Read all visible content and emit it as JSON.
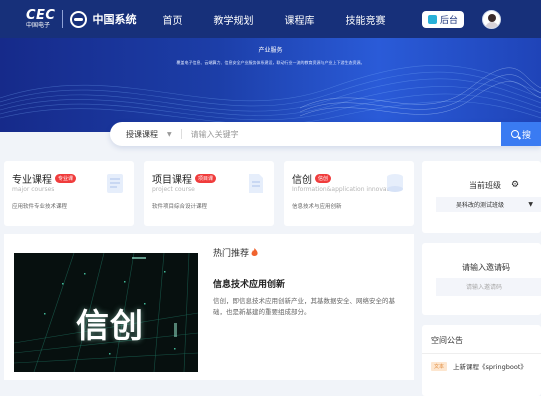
{
  "header": {
    "cec_logo": "CEC",
    "cec_subtitle": "中国电子",
    "partner_logo": "中国系统",
    "nav": [
      "首页",
      "教学规划",
      "课程库",
      "技能竞赛"
    ],
    "backend_label": "后台"
  },
  "banner": {
    "title": "产业服务",
    "subtitle": "覆盖电子信息、云端算力、信息安全产业服务体系建设，联动行业一流的教育资源与产业上下游生态资源。"
  },
  "search": {
    "category": "授课课程",
    "placeholder": "请输入关键字",
    "button_label": "搜"
  },
  "cards": [
    {
      "title": "专业课程",
      "tag": "专业课",
      "en": "major courses",
      "desc": "应用软件专业技术课程"
    },
    {
      "title": "项目课程",
      "tag": "项目课",
      "en": "project course",
      "desc": "软件项目综合设计课程"
    },
    {
      "title": "信创",
      "tag": "信创",
      "en": "Information&application innovation",
      "desc": "信息技术与应用创新"
    }
  ],
  "current_class": {
    "title": "当前班级",
    "selected": "吴科改的测试班级"
  },
  "invite": {
    "title": "请输入邀请码",
    "placeholder": "请输入邀请码"
  },
  "notice": {
    "title": "空间公告",
    "items": [
      {
        "tag": "文本",
        "text": "上新课程《springboot》"
      }
    ]
  },
  "hot": {
    "heading": "热门推荐",
    "image_text": "信创",
    "title": "信息技术应用创新",
    "desc": "信创，即信息技术应用创新产业，其基数据安全、网络安全的基础，也是新基建的重要组成部分。"
  },
  "colors": {
    "nav_bg": "#17307a",
    "accent": "#3a7bf2",
    "tag_red": "#f03c3c"
  }
}
